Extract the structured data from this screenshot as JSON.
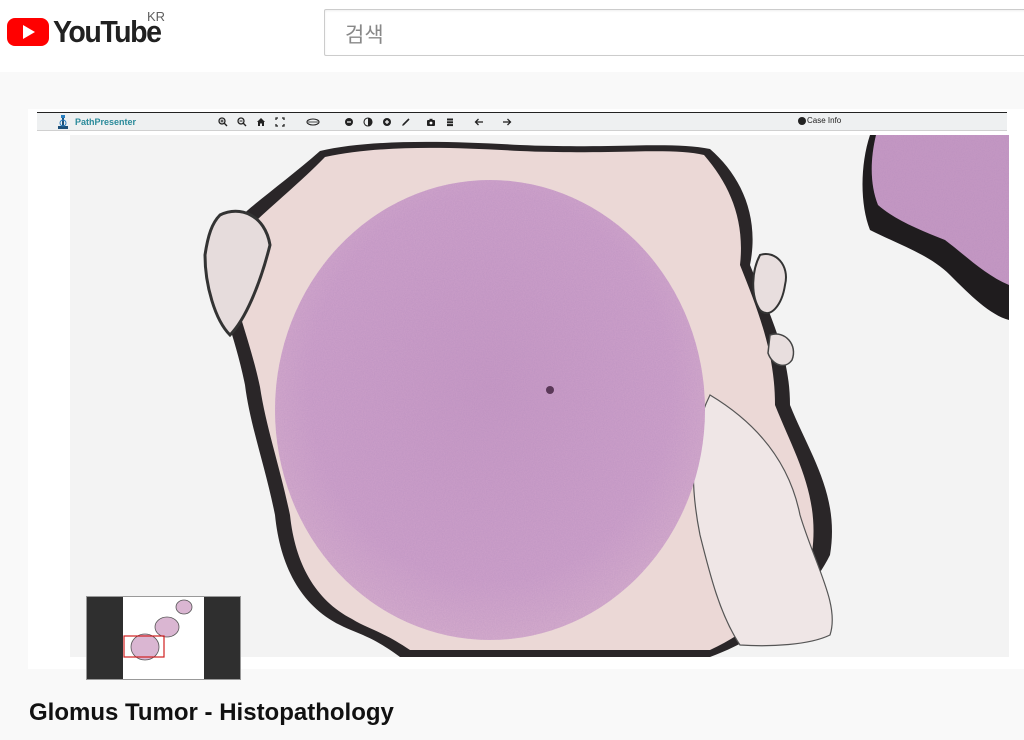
{
  "header": {
    "logo_text": "YouTube",
    "country_code": "KR",
    "search_placeholder": "검색"
  },
  "viewer": {
    "brand": "PathPresenter",
    "toolbar_icons": [
      "zoom-in-icon",
      "zoom-out-icon",
      "home-icon",
      "fullscreen-icon",
      "slide-icon",
      "minus-circle-icon",
      "contrast-icon",
      "plus-circle-icon",
      "pen-icon",
      "camera-icon",
      "layers-icon",
      "arrow-left-icon",
      "arrow-right-icon"
    ],
    "case_info_label": "Case Info",
    "colors": {
      "tissue": "#cc9bc6",
      "ink": "#1e1e1e",
      "background": "#f3f3f3",
      "brand": "#2a8a9a"
    }
  },
  "video": {
    "title": "Glomus Tumor - Histopathology"
  }
}
